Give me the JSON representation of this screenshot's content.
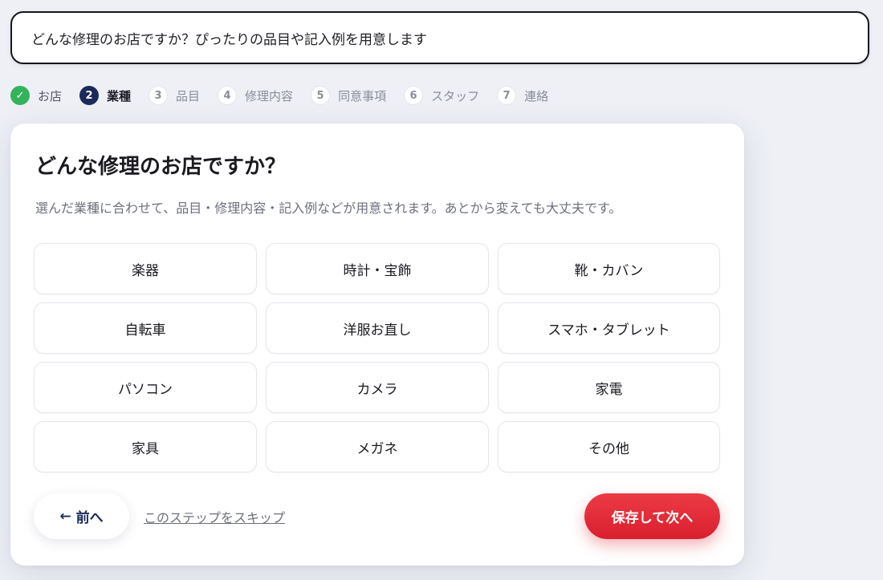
{
  "banner": {
    "text": "どんな修理のお店ですか？ぴったりの品目や記入例を用意します"
  },
  "steps": [
    {
      "num": "✓",
      "label": "お店",
      "state": "done"
    },
    {
      "num": "2",
      "label": "業種",
      "state": "current"
    },
    {
      "num": "3",
      "label": "品目",
      "state": "todo"
    },
    {
      "num": "4",
      "label": "修理内容",
      "state": "todo"
    },
    {
      "num": "5",
      "label": "同意事項",
      "state": "todo"
    },
    {
      "num": "6",
      "label": "スタッフ",
      "state": "todo"
    },
    {
      "num": "7",
      "label": "連絡",
      "state": "todo"
    }
  ],
  "card": {
    "title": "どんな修理のお店ですか？",
    "description": "選んだ業種に合わせて、品目・修理内容・記入例などが用意されます。あとから変えても大丈夫です。"
  },
  "options": [
    "楽器",
    "時計・宝飾",
    "靴・カバン",
    "自転車",
    "洋服お直し",
    "スマホ・タブレット",
    "パソコン",
    "カメラ",
    "家電",
    "家具",
    "メガネ",
    "その他"
  ],
  "footer": {
    "back_arrow": "←",
    "back_label": "前へ",
    "skip_label": "このステップをスキップ",
    "next_label": "保存して次へ"
  },
  "colors": {
    "accent_red": "#e02837",
    "navy": "#1b2a5c",
    "done_green": "#34b35a"
  }
}
